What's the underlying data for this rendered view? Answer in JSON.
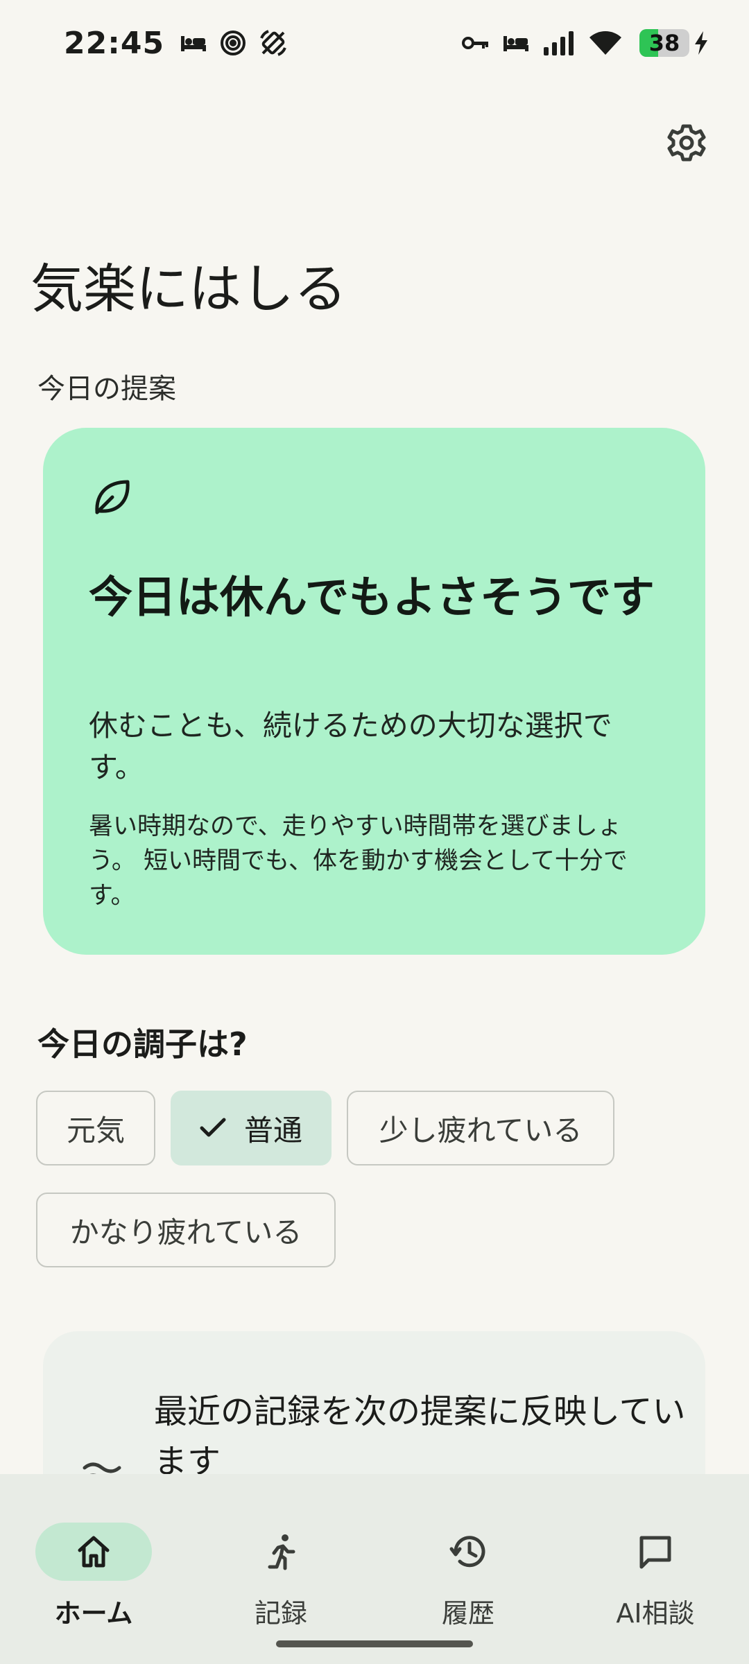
{
  "status_bar": {
    "time": "22:45",
    "battery": "38",
    "left_icons": [
      "bed-icon",
      "spiral-icon",
      "rotate-off-icon"
    ],
    "right_icons": [
      "key-icon",
      "bed-icon",
      "signal-icon",
      "wifi-icon",
      "battery-icon",
      "charging-icon"
    ]
  },
  "header": {
    "settings_icon": "gear-icon",
    "title": "気楽にはしる"
  },
  "suggestion": {
    "section_label": "今日の提案",
    "icon": "leaf-icon",
    "title": "今日は休んでもよさそうです",
    "subtitle": "休むことも、続けるための大切な選択です。",
    "body": "暑い時期なので、走りやすい時間帯を選びましょう。 短い時間でも、体を動かす機会として十分です。",
    "card_color": "#adf2cb"
  },
  "mood": {
    "label": "今日の調子は?",
    "options": [
      {
        "label": "元気",
        "selected": false
      },
      {
        "label": "普通",
        "selected": true
      },
      {
        "label": "少し疲れている",
        "selected": false
      },
      {
        "label": "かなり疲れている",
        "selected": false
      }
    ]
  },
  "info": {
    "icon": "waves-icon",
    "text": "最近の記録を次の提案に反映しています"
  },
  "nav": {
    "items": [
      {
        "label": "ホーム",
        "icon": "home-icon",
        "active": true
      },
      {
        "label": "記録",
        "icon": "running-icon",
        "active": false
      },
      {
        "label": "履歴",
        "icon": "history-icon",
        "active": false
      },
      {
        "label": "AI相談",
        "icon": "chat-icon",
        "active": false
      }
    ]
  },
  "colors": {
    "background": "#f7f6f1",
    "accent": "#c3e8d1",
    "selected_chip": "#d2e8dc"
  }
}
